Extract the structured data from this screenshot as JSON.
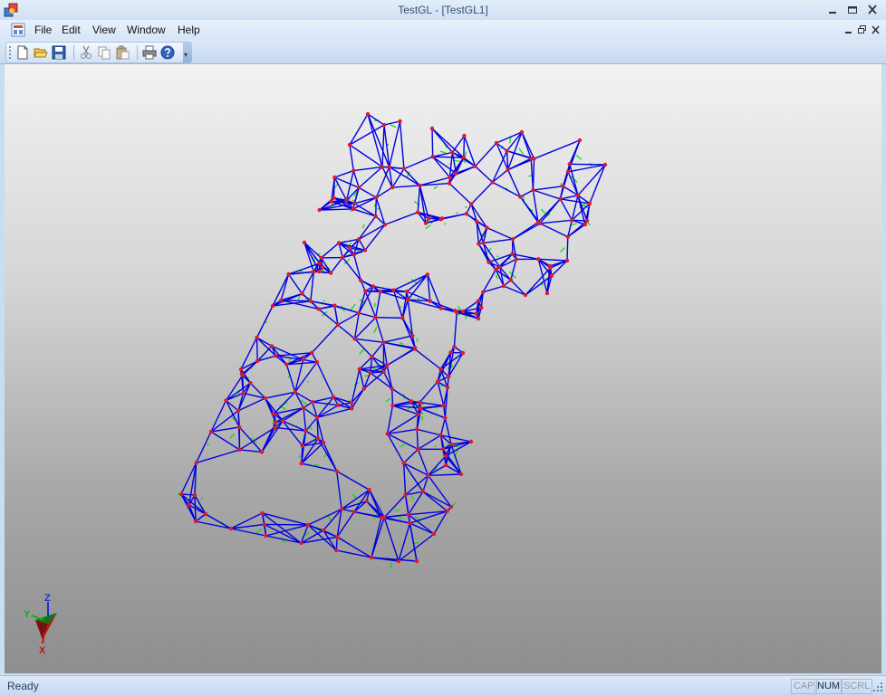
{
  "window": {
    "title": "TestGL - [TestGL1]"
  },
  "menu": {
    "items": [
      "File",
      "Edit",
      "View",
      "Window",
      "Help"
    ]
  },
  "toolbar": {
    "buttons": [
      "new-icon",
      "open-icon",
      "save-icon",
      "cut-icon",
      "copy-icon",
      "paste-icon",
      "print-icon",
      "help-icon"
    ]
  },
  "axis": {
    "z": "Z",
    "y": "Y",
    "x": "X"
  },
  "status": {
    "text": "Ready",
    "indicators": [
      "CAP",
      "NUM",
      "SCRL"
    ],
    "active": [
      "NUM"
    ]
  },
  "colors": {
    "edge": "#0000e0",
    "vertex": "#e0182c",
    "interior": "#00dd00"
  }
}
